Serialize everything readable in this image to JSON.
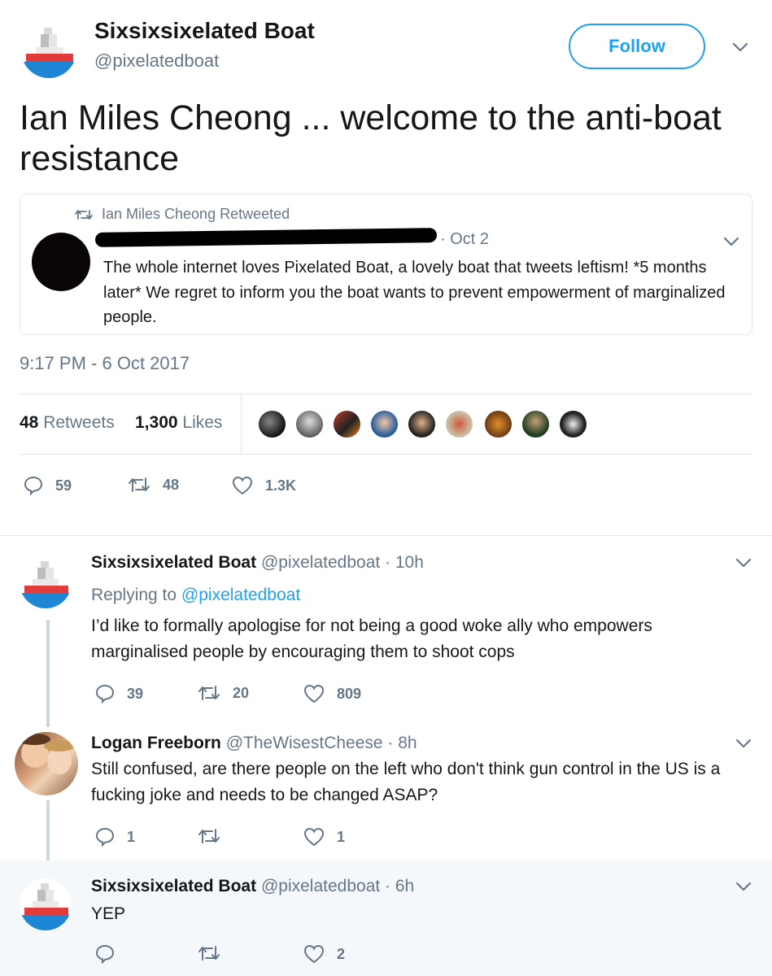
{
  "main_tweet": {
    "display_name": "Sixsixsixelated Boat",
    "handle": "@pixelatedboat",
    "follow_label": "Follow",
    "text": "Ian Miles Cheong ... welcome to the anti-boat resistance",
    "timestamp": "9:17 PM - 6 Oct 2017",
    "stats": {
      "retweets_count": "48",
      "retweets_label": "Retweets",
      "likes_count": "1,300",
      "likes_label": "Likes"
    },
    "actions": {
      "replies": "59",
      "retweets": "48",
      "likes": "1.3K"
    }
  },
  "quoted_tweet": {
    "retweeted_by": "Ian Miles Cheong Retweeted",
    "date": "· Oct 2",
    "text": "The whole internet loves Pixelated Boat, a lovely boat that tweets leftism! *5 months later* We regret to inform you the boat wants to prevent empowerment of marginalized people."
  },
  "replies": [
    {
      "display_name": "Sixsixsixelated Boat",
      "handle_time": "@pixelatedboat · 10h",
      "replying_prefix": "Replying to",
      "replying_handle": "@pixelatedboat",
      "text": "I’d like to formally apologise for not being a good woke ally who empowers marginalised people by encouraging them to shoot cops",
      "actions": {
        "replies": "39",
        "retweets": "20",
        "likes": "809"
      }
    },
    {
      "display_name": "Logan Freeborn",
      "handle_time": "@TheWisestCheese · 8h",
      "text": "Still confused, are there people on the left who don't think gun control in the US is a fucking joke and needs to be changed ASAP?",
      "actions": {
        "replies": "1",
        "retweets": "",
        "likes": "1"
      }
    },
    {
      "display_name": "Sixsixsixelated Boat",
      "handle_time": "@pixelatedboat · 6h",
      "text": "YEP",
      "actions": {
        "replies": "",
        "retweets": "",
        "likes": "2"
      }
    }
  ],
  "colors": {
    "accent": "#1da1f2",
    "muted": "#657786",
    "text": "#14171a",
    "border": "#e1e8ed",
    "highlight_bg": "#f5f8fa"
  }
}
